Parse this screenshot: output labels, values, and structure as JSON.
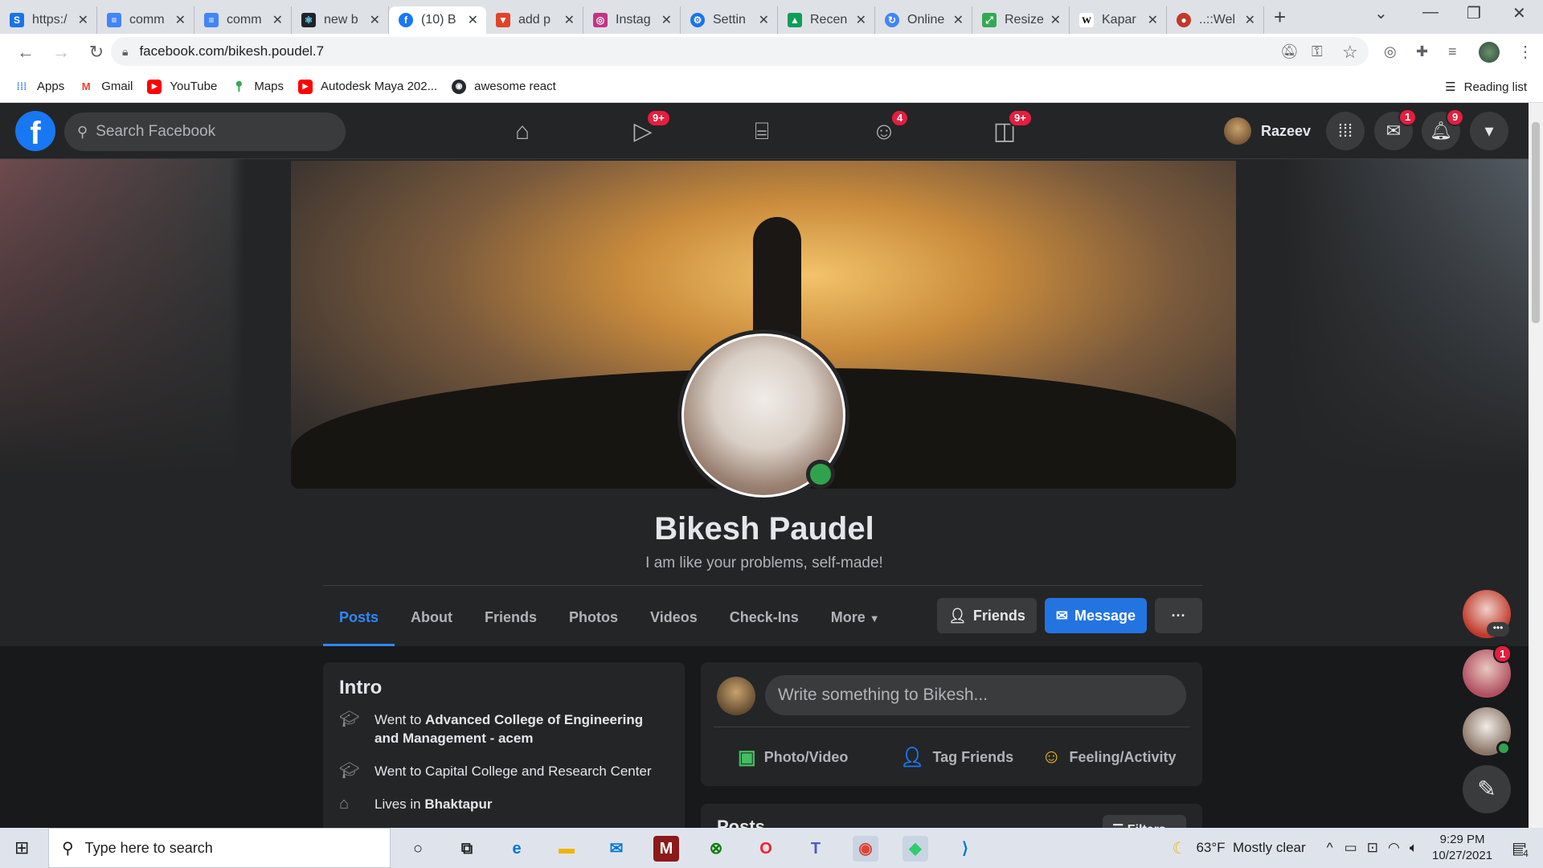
{
  "browser": {
    "tabs": [
      {
        "title": "https:/",
        "icon": "sheets-icon",
        "color": "#1a73e8"
      },
      {
        "title": "comm",
        "icon": "docs-icon",
        "color": "#4285f4"
      },
      {
        "title": "comm",
        "icon": "docs-icon",
        "color": "#4285f4"
      },
      {
        "title": "new b",
        "icon": "react-icon",
        "color": "#20232a"
      },
      {
        "title": "(10) B",
        "icon": "facebook-icon",
        "color": "#1877f2"
      },
      {
        "title": "add p",
        "icon": "gitlab-icon",
        "color": "#e24329"
      },
      {
        "title": "Instag",
        "icon": "instagram-icon",
        "color": "#c13584"
      },
      {
        "title": "Settin",
        "icon": "gear-icon",
        "color": "#1a73e8"
      },
      {
        "title": "Recen",
        "icon": "drive-icon",
        "color": "#0f9d58"
      },
      {
        "title": "Online",
        "icon": "sync-icon",
        "color": "#4285f4"
      },
      {
        "title": "Resize",
        "icon": "resize-icon",
        "color": "#34a853"
      },
      {
        "title": "Kapar",
        "icon": "wikipedia-icon",
        "color": "#000000"
      },
      {
        "title": "..::Wel",
        "icon": "site-icon",
        "color": "#c0392b"
      }
    ],
    "url": "facebook.com/bikesh.poudel.7",
    "bookmarks": [
      {
        "label": "Apps"
      },
      {
        "label": "Gmail"
      },
      {
        "label": "YouTube"
      },
      {
        "label": "Maps"
      },
      {
        "label": "Autodesk Maya 202..."
      },
      {
        "label": "awesome react"
      }
    ],
    "reading_list": "Reading list"
  },
  "fb": {
    "search_placeholder": "Search Facebook",
    "badges": {
      "watch": "9+",
      "groups": "4",
      "gaming": "9+",
      "messenger": "1",
      "notifications": "9"
    },
    "user_name": "Razeev",
    "profile": {
      "name": "Bikesh Paudel",
      "bio": "I am like your problems, self-made!",
      "tabs": [
        "Posts",
        "About",
        "Friends",
        "Photos",
        "Videos",
        "Check-Ins",
        "More"
      ],
      "friends_btn": "Friends",
      "message_btn": "Message",
      "more_btn": "···"
    },
    "intro": {
      "title": "Intro",
      "items": [
        {
          "prefix": "Went to ",
          "bold": "Advanced College of Engineering and Management - acem"
        },
        {
          "prefix": "Went to Capital College and Research Center",
          "bold": ""
        },
        {
          "prefix": "Lives in ",
          "bold": "Bhaktapur"
        }
      ]
    },
    "composer": {
      "placeholder": "Write something to Bikesh...",
      "photo": "Photo/Video",
      "tag": "Tag Friends",
      "feeling": "Feeling/Activity"
    },
    "posts_title": "Posts",
    "filters": "Filters",
    "rail_badge": "1"
  },
  "taskbar": {
    "search_placeholder": "Type here to search",
    "weather": "63°F  Mostly clear",
    "time": "9:29 PM",
    "date": "10/27/2021",
    "notif_count": "4"
  },
  "colors": {
    "accent": "#1877f2",
    "fb_bg": "#18191a",
    "fb_card": "#242526",
    "badge": "#e41e3f",
    "online": "#31a24c"
  }
}
